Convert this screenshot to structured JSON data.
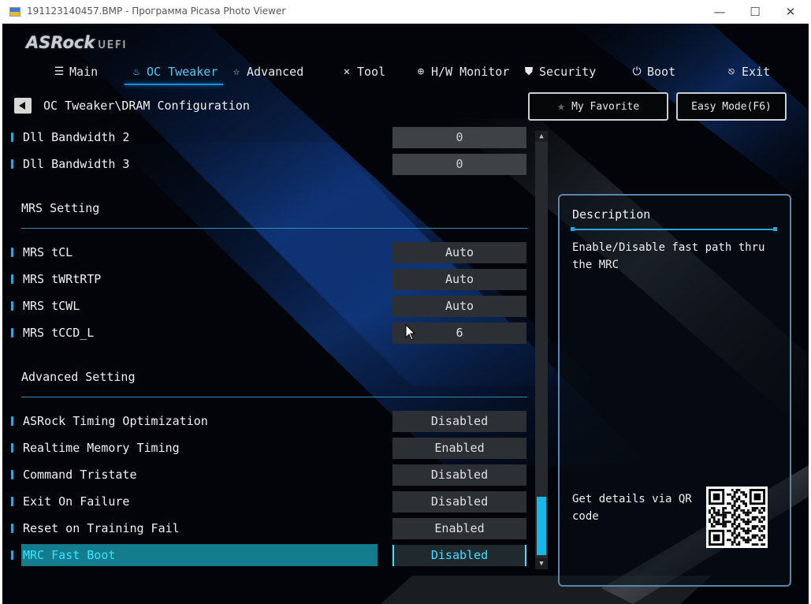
{
  "window": {
    "title": "191123140457.BMP - Программа Picasa Photo Viewer",
    "controls": {
      "minimize": "—",
      "maximize": "☐",
      "close": "✕"
    }
  },
  "bios": {
    "logo": {
      "brand": "ASRock",
      "suffix": "UEFI"
    },
    "tabs": [
      {
        "label": "Main",
        "icon": "list-icon"
      },
      {
        "label": "OC Tweaker",
        "icon": "flame-icon",
        "active": true
      },
      {
        "label": "Advanced",
        "icon": "star-outline-icon"
      },
      {
        "label": "Tool",
        "icon": "wrench-icon"
      },
      {
        "label": "H/W Monitor",
        "icon": "monitor-icon"
      },
      {
        "label": "Security",
        "icon": "shield-icon"
      },
      {
        "label": "Boot",
        "icon": "power-icon"
      },
      {
        "label": "Exit",
        "icon": "exit-icon"
      }
    ],
    "breadcrumb": "OC Tweaker\\DRAM Configuration",
    "my_favorite": "My Favorite",
    "easy_mode": "Easy Mode(F6)",
    "settings_top": [
      {
        "label": "Dll Bandwidth 2",
        "value": "0"
      },
      {
        "label": "Dll Bandwidth 3",
        "value": "0"
      }
    ],
    "section_mrs": "MRS Setting",
    "settings_mrs": [
      {
        "label": "MRS tCL",
        "value": "Auto"
      },
      {
        "label": "MRS tWRtRTP",
        "value": "Auto"
      },
      {
        "label": "MRS tCWL",
        "value": "Auto"
      },
      {
        "label": "MRS tCCD_L",
        "value": "6"
      }
    ],
    "section_advanced": "Advanced Setting",
    "settings_adv": [
      {
        "label": "ASRock Timing Optimization",
        "value": "Disabled"
      },
      {
        "label": "Realtime Memory Timing",
        "value": "Enabled"
      },
      {
        "label": "Command Tristate",
        "value": "Disabled"
      },
      {
        "label": "Exit On Failure",
        "value": "Disabled"
      },
      {
        "label": "Reset on Training Fail",
        "value": "Enabled"
      },
      {
        "label": "MRC Fast Boot",
        "value": "Disabled",
        "selected": true
      }
    ],
    "description": {
      "title": "Description",
      "text": "Enable/Disable fast path thru the MRC",
      "qr_text": "Get details via QR code"
    },
    "colors": {
      "accent": "#3fd0ff",
      "selection": "#137d8d",
      "value_bg": "#2c2f33"
    }
  }
}
